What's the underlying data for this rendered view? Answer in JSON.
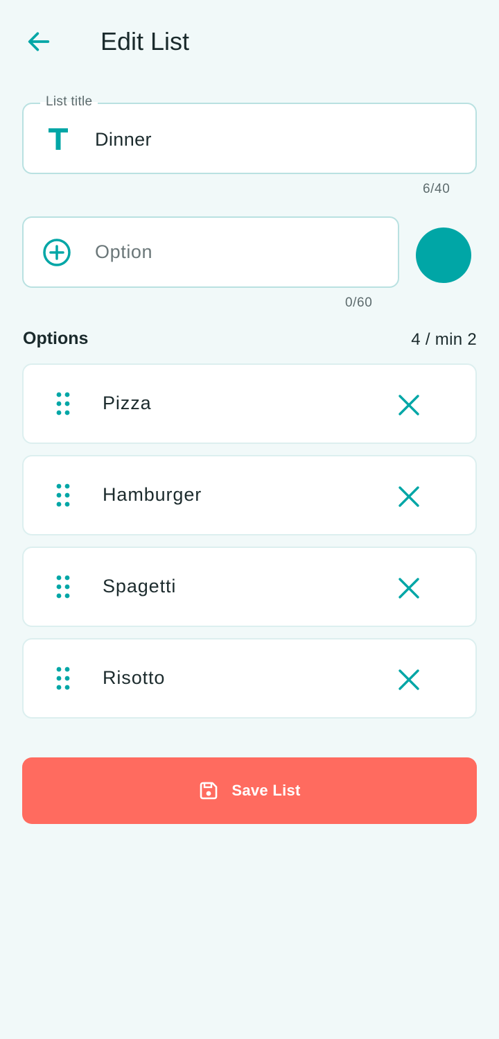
{
  "header": {
    "title": "Edit List",
    "back_icon": "arrow-left-icon"
  },
  "title_field": {
    "legend": "List title",
    "value": "Dinner",
    "counter": "6/40",
    "icon": "text-T-icon"
  },
  "option_field": {
    "placeholder": "Option",
    "value": "",
    "counter": "0/60",
    "icon": "add-circle-icon"
  },
  "color_picker": {
    "color": "#00a6a6"
  },
  "options_section": {
    "heading": "Options",
    "count_label": "4 / min 2",
    "items": [
      {
        "label": "Pizza"
      },
      {
        "label": "Hamburger"
      },
      {
        "label": "Spagetti"
      },
      {
        "label": "Risotto"
      }
    ]
  },
  "save_button": {
    "label": "Save List",
    "icon": "save-icon",
    "color": "#ff6b5f"
  },
  "colors": {
    "accent": "#00a6a6",
    "background": "#f1f9f9"
  }
}
